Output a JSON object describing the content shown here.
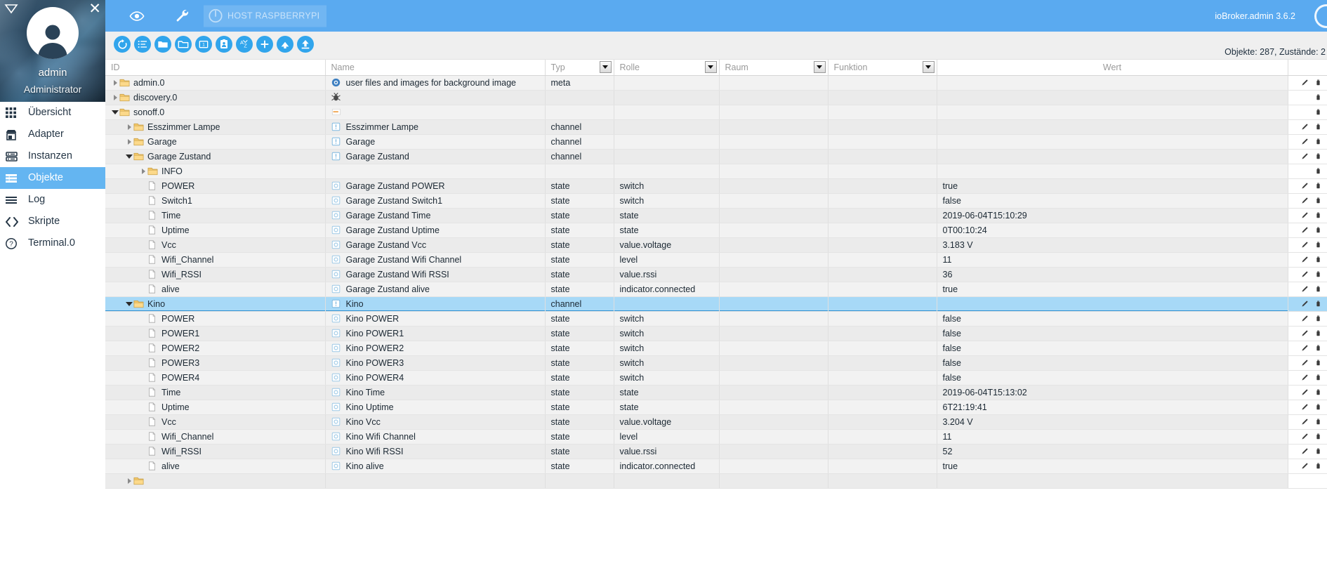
{
  "profile": {
    "name": "admin",
    "role": "Administrator",
    "caret_icon": "caret-down-icon",
    "close_icon": "close-icon",
    "avatar_icon": "user-avatar-icon"
  },
  "sidebar": {
    "items": [
      {
        "label": "Übersicht",
        "icon": "grid-icon",
        "active": false
      },
      {
        "label": "Adapter",
        "icon": "store-icon",
        "active": false
      },
      {
        "label": "Instanzen",
        "icon": "server-icon",
        "active": false
      },
      {
        "label": "Objekte",
        "icon": "list-alt-icon",
        "active": true
      },
      {
        "label": "Log",
        "icon": "lines-icon",
        "active": false
      },
      {
        "label": "Skripte",
        "icon": "code-icon",
        "active": false
      },
      {
        "label": "Terminal.0",
        "icon": "question-circle-icon",
        "active": false
      }
    ]
  },
  "topbar": {
    "eye_icon": "eye-icon",
    "wrench_icon": "wrench-icon",
    "power_icon": "power-icon",
    "host_label": "HOST RASPBERRYPI",
    "version": "ioBroker.admin 3.6.2",
    "bg_color": "#5aaaf0"
  },
  "toolbar": {
    "buttons": [
      {
        "name": "refresh-button",
        "icon": "refresh-icon"
      },
      {
        "name": "expand-list-button",
        "icon": "list-icon"
      },
      {
        "name": "expand-all-button",
        "icon": "folder-open-icon"
      },
      {
        "name": "collapse-all-button",
        "icon": "folder-icon"
      },
      {
        "name": "expand-one-level-button",
        "icon": "folder-one-icon"
      },
      {
        "name": "show-id-button",
        "icon": "id-card-icon"
      },
      {
        "name": "sort-az-button",
        "icon": "sort-az-icon"
      },
      {
        "name": "add-object-button",
        "icon": "plus-icon"
      },
      {
        "name": "import-button",
        "icon": "upload-cloud-icon"
      },
      {
        "name": "export-button",
        "icon": "upload-icon"
      }
    ],
    "counts": "Objekte: 287, Zustände: 2"
  },
  "table": {
    "columns": [
      {
        "key": "id",
        "label": "ID",
        "filter": false
      },
      {
        "key": "name",
        "label": "Name",
        "filter": false
      },
      {
        "key": "typ",
        "label": "Typ",
        "filter": true
      },
      {
        "key": "rolle",
        "label": "Rolle",
        "filter": true
      },
      {
        "key": "raum",
        "label": "Raum",
        "filter": true
      },
      {
        "key": "funk",
        "label": "Funktion",
        "filter": true
      },
      {
        "key": "wert",
        "label": "Wert",
        "filter": false
      }
    ],
    "edit_icon": "pencil-icon",
    "delete_icon": "trash-icon",
    "rows": [
      {
        "id": "admin.0",
        "indent": 0,
        "arrow": "closed",
        "icon": "folder-icon",
        "name": "user files and images for background image",
        "name_icon": "settings-gear-icon",
        "typ": "meta",
        "rolle": "",
        "raum": "",
        "funk": "",
        "wert": "",
        "edit": true,
        "del": true,
        "selected": false
      },
      {
        "id": "discovery.0",
        "indent": 0,
        "arrow": "closed",
        "icon": "folder-icon",
        "name": "",
        "name_icon": "bug-icon",
        "typ": "",
        "rolle": "",
        "raum": "",
        "funk": "",
        "wert": "",
        "edit": false,
        "del": true,
        "selected": false
      },
      {
        "id": "sonoff.0",
        "indent": 0,
        "arrow": "open",
        "icon": "folder-icon",
        "name": "",
        "name_icon": "sonoff-icon",
        "typ": "",
        "rolle": "",
        "raum": "",
        "funk": "",
        "wert": "",
        "edit": false,
        "del": true,
        "selected": false
      },
      {
        "id": "Esszimmer Lampe",
        "indent": 1,
        "arrow": "closed",
        "icon": "folder-icon",
        "name": "Esszimmer Lampe",
        "name_icon": "channel-icon",
        "typ": "channel",
        "rolle": "",
        "raum": "",
        "funk": "",
        "wert": "",
        "edit": true,
        "del": true,
        "selected": false
      },
      {
        "id": "Garage",
        "indent": 1,
        "arrow": "closed",
        "icon": "folder-icon",
        "name": "Garage",
        "name_icon": "channel-icon",
        "typ": "channel",
        "rolle": "",
        "raum": "",
        "funk": "",
        "wert": "",
        "edit": true,
        "del": true,
        "selected": false
      },
      {
        "id": "Garage Zustand",
        "indent": 1,
        "arrow": "open",
        "icon": "folder-icon",
        "name": "Garage Zustand",
        "name_icon": "channel-icon",
        "typ": "channel",
        "rolle": "",
        "raum": "",
        "funk": "",
        "wert": "",
        "edit": true,
        "del": true,
        "selected": false
      },
      {
        "id": "INFO",
        "indent": 2,
        "arrow": "closed",
        "icon": "folder-icon",
        "name": "",
        "name_icon": "",
        "typ": "",
        "rolle": "",
        "raum": "",
        "funk": "",
        "wert": "",
        "edit": false,
        "del": true,
        "selected": false
      },
      {
        "id": "POWER",
        "indent": 2,
        "arrow": "none",
        "icon": "file-icon",
        "name": "Garage Zustand POWER",
        "name_icon": "state-icon",
        "typ": "state",
        "rolle": "switch",
        "raum": "",
        "funk": "",
        "wert": "true",
        "edit": true,
        "del": true,
        "selected": false
      },
      {
        "id": "Switch1",
        "indent": 2,
        "arrow": "none",
        "icon": "file-icon",
        "name": "Garage Zustand Switch1",
        "name_icon": "state-icon",
        "typ": "state",
        "rolle": "switch",
        "raum": "",
        "funk": "",
        "wert": "false",
        "edit": true,
        "del": true,
        "selected": false
      },
      {
        "id": "Time",
        "indent": 2,
        "arrow": "none",
        "icon": "file-icon",
        "name": "Garage Zustand Time",
        "name_icon": "state-icon",
        "typ": "state",
        "rolle": "state",
        "raum": "",
        "funk": "",
        "wert": "2019-06-04T15:10:29",
        "edit": true,
        "del": true,
        "selected": false
      },
      {
        "id": "Uptime",
        "indent": 2,
        "arrow": "none",
        "icon": "file-icon",
        "name": "Garage Zustand Uptime",
        "name_icon": "state-icon",
        "typ": "state",
        "rolle": "state",
        "raum": "",
        "funk": "",
        "wert": "0T00:10:24",
        "edit": true,
        "del": true,
        "selected": false
      },
      {
        "id": "Vcc",
        "indent": 2,
        "arrow": "none",
        "icon": "file-icon",
        "name": "Garage Zustand Vcc",
        "name_icon": "state-icon",
        "typ": "state",
        "rolle": "value.voltage",
        "raum": "",
        "funk": "",
        "wert": "3.183 V",
        "edit": true,
        "del": true,
        "selected": false
      },
      {
        "id": "Wifi_Channel",
        "indent": 2,
        "arrow": "none",
        "icon": "file-icon",
        "name": "Garage Zustand Wifi Channel",
        "name_icon": "state-icon",
        "typ": "state",
        "rolle": "level",
        "raum": "",
        "funk": "",
        "wert": "11",
        "edit": true,
        "del": true,
        "selected": false
      },
      {
        "id": "Wifi_RSSI",
        "indent": 2,
        "arrow": "none",
        "icon": "file-icon",
        "name": "Garage Zustand Wifi RSSI",
        "name_icon": "state-icon",
        "typ": "state",
        "rolle": "value.rssi",
        "raum": "",
        "funk": "",
        "wert": "36",
        "edit": true,
        "del": true,
        "selected": false
      },
      {
        "id": "alive",
        "indent": 2,
        "arrow": "none",
        "icon": "file-icon",
        "name": "Garage Zustand alive",
        "name_icon": "state-icon",
        "typ": "state",
        "rolle": "indicator.connected",
        "raum": "",
        "funk": "",
        "wert": "true",
        "edit": true,
        "del": true,
        "selected": false
      },
      {
        "id": "Kino",
        "indent": 1,
        "arrow": "open",
        "icon": "folder-icon",
        "name": "Kino",
        "name_icon": "channel-icon",
        "typ": "channel",
        "rolle": "",
        "raum": "",
        "funk": "",
        "wert": "",
        "edit": true,
        "del": true,
        "selected": true
      },
      {
        "id": "POWER",
        "indent": 2,
        "arrow": "none",
        "icon": "file-icon",
        "name": "Kino POWER",
        "name_icon": "state-icon",
        "typ": "state",
        "rolle": "switch",
        "raum": "",
        "funk": "",
        "wert": "false",
        "edit": true,
        "del": true,
        "selected": false
      },
      {
        "id": "POWER1",
        "indent": 2,
        "arrow": "none",
        "icon": "file-icon",
        "name": "Kino POWER1",
        "name_icon": "state-icon",
        "typ": "state",
        "rolle": "switch",
        "raum": "",
        "funk": "",
        "wert": "false",
        "edit": true,
        "del": true,
        "selected": false
      },
      {
        "id": "POWER2",
        "indent": 2,
        "arrow": "none",
        "icon": "file-icon",
        "name": "Kino POWER2",
        "name_icon": "state-icon",
        "typ": "state",
        "rolle": "switch",
        "raum": "",
        "funk": "",
        "wert": "false",
        "edit": true,
        "del": true,
        "selected": false
      },
      {
        "id": "POWER3",
        "indent": 2,
        "arrow": "none",
        "icon": "file-icon",
        "name": "Kino POWER3",
        "name_icon": "state-icon",
        "typ": "state",
        "rolle": "switch",
        "raum": "",
        "funk": "",
        "wert": "false",
        "edit": true,
        "del": true,
        "selected": false
      },
      {
        "id": "POWER4",
        "indent": 2,
        "arrow": "none",
        "icon": "file-icon",
        "name": "Kino POWER4",
        "name_icon": "state-icon",
        "typ": "state",
        "rolle": "switch",
        "raum": "",
        "funk": "",
        "wert": "false",
        "edit": true,
        "del": true,
        "selected": false
      },
      {
        "id": "Time",
        "indent": 2,
        "arrow": "none",
        "icon": "file-icon",
        "name": "Kino Time",
        "name_icon": "state-icon",
        "typ": "state",
        "rolle": "state",
        "raum": "",
        "funk": "",
        "wert": "2019-06-04T15:13:02",
        "edit": true,
        "del": true,
        "selected": false
      },
      {
        "id": "Uptime",
        "indent": 2,
        "arrow": "none",
        "icon": "file-icon",
        "name": "Kino Uptime",
        "name_icon": "state-icon",
        "typ": "state",
        "rolle": "state",
        "raum": "",
        "funk": "",
        "wert": "6T21:19:41",
        "edit": true,
        "del": true,
        "selected": false
      },
      {
        "id": "Vcc",
        "indent": 2,
        "arrow": "none",
        "icon": "file-icon",
        "name": "Kino Vcc",
        "name_icon": "state-icon",
        "typ": "state",
        "rolle": "value.voltage",
        "raum": "",
        "funk": "",
        "wert": "3.204 V",
        "edit": true,
        "del": true,
        "selected": false
      },
      {
        "id": "Wifi_Channel",
        "indent": 2,
        "arrow": "none",
        "icon": "file-icon",
        "name": "Kino Wifi Channel",
        "name_icon": "state-icon",
        "typ": "state",
        "rolle": "level",
        "raum": "",
        "funk": "",
        "wert": "11",
        "edit": true,
        "del": true,
        "selected": false
      },
      {
        "id": "Wifi_RSSI",
        "indent": 2,
        "arrow": "none",
        "icon": "file-icon",
        "name": "Kino Wifi RSSI",
        "name_icon": "state-icon",
        "typ": "state",
        "rolle": "value.rssi",
        "raum": "",
        "funk": "",
        "wert": "52",
        "edit": true,
        "del": true,
        "selected": false
      },
      {
        "id": "alive",
        "indent": 2,
        "arrow": "none",
        "icon": "file-icon",
        "name": "Kino alive",
        "name_icon": "state-icon",
        "typ": "state",
        "rolle": "indicator.connected",
        "raum": "",
        "funk": "",
        "wert": "true",
        "edit": true,
        "del": true,
        "selected": false
      },
      {
        "id": "",
        "indent": 1,
        "arrow": "closed",
        "icon": "folder-icon",
        "name": "",
        "name_icon": "",
        "typ": "",
        "rolle": "",
        "raum": "",
        "funk": "",
        "wert": "",
        "edit": false,
        "del": false,
        "selected": false
      }
    ]
  }
}
